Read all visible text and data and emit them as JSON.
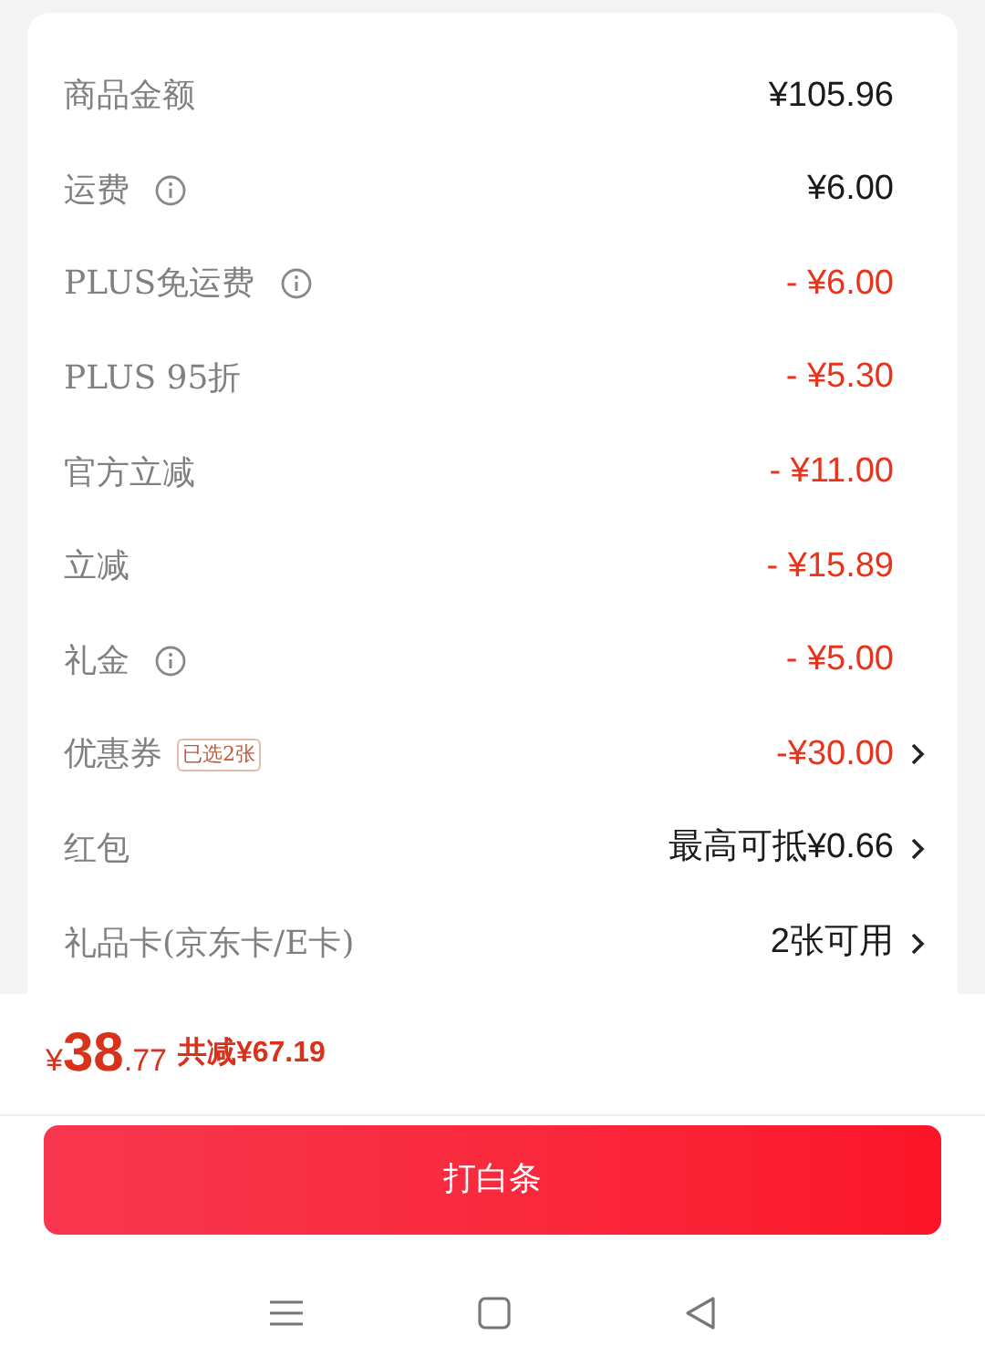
{
  "rows": [
    {
      "label": "商品金额",
      "info": false,
      "value": "¥105.96",
      "kind": "normal",
      "arrow": false
    },
    {
      "label": "运费",
      "info": true,
      "value": "¥6.00",
      "kind": "normal",
      "arrow": false
    },
    {
      "label": "PLUS免运费",
      "info": true,
      "value": "- ¥6.00",
      "kind": "deduction",
      "arrow": false
    },
    {
      "label": "PLUS 95折",
      "info": false,
      "value": "- ¥5.30",
      "kind": "deduction",
      "arrow": false
    },
    {
      "label": "官方立减",
      "info": false,
      "value": "- ¥11.00",
      "kind": "deduction",
      "arrow": false
    },
    {
      "label": "立减",
      "info": false,
      "value": "- ¥15.89",
      "kind": "deduction",
      "arrow": false
    },
    {
      "label": "礼金",
      "info": true,
      "value": "- ¥5.00",
      "kind": "deduction",
      "arrow": false
    },
    {
      "label": "优惠券",
      "info": false,
      "tag": "已选2张",
      "value": "-¥30.00",
      "kind": "deduction",
      "arrow": true
    },
    {
      "label": "红包",
      "info": false,
      "value": "最高可抵¥0.66",
      "kind": "normal",
      "arrow": true
    },
    {
      "label": "礼品卡(京东卡/E卡)",
      "info": false,
      "value": "2张可用",
      "kind": "normal",
      "arrow": true
    }
  ],
  "total": {
    "currency": "¥",
    "integer": "38",
    "decimal": ".77",
    "saved": "共减¥67.19"
  },
  "pay_button": "打白条"
}
